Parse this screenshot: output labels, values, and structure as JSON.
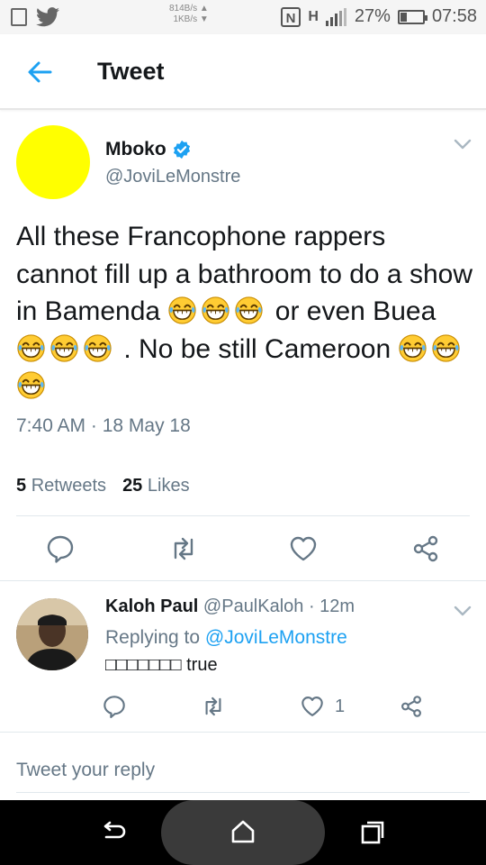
{
  "status_bar": {
    "net_up": "814B/s ▲",
    "net_down": "1KB/s ▼",
    "signal_type": "H",
    "battery": "27%",
    "battery_level": 0.27,
    "time": "07:58"
  },
  "app_bar": {
    "back_icon": "arrow-left-icon",
    "title": "Tweet"
  },
  "tweet": {
    "avatar_color": "#ffff00",
    "author_name": "Mboko",
    "verified": true,
    "author_handle": "@JoviLeMonstre",
    "text_segments": [
      "All these Francophone rappers cannot fill up a bathroom to do a show in Bamenda ",
      " or even Buea ",
      " . No be still Cameroon "
    ],
    "emoji_name": "face-with-tears-of-joy",
    "timestamp": "7:40 AM · 18 May 18",
    "retweets_count": "5",
    "retweets_label": "Retweets",
    "likes_count": "25",
    "likes_label": "Likes",
    "actions": [
      "reply-icon",
      "retweet-icon",
      "like-icon",
      "share-icon"
    ]
  },
  "reply": {
    "author_name": "Kaloh Paul",
    "author_handle": "@PaulKaloh",
    "time": "· 12m",
    "replying_prefix": "Replying to",
    "replying_to": "@JoviLeMonstre",
    "text": "□□□□□□□ true",
    "like_count": "1"
  },
  "composer": {
    "placeholder": "Tweet your reply"
  },
  "nav_bar": {
    "buttons": [
      "back-icon",
      "home-icon",
      "recents-icon"
    ]
  },
  "colors": {
    "accent": "#1da1f2",
    "text_primary": "#14171a",
    "text_secondary": "#657786",
    "emoji": "#ffcc33"
  }
}
